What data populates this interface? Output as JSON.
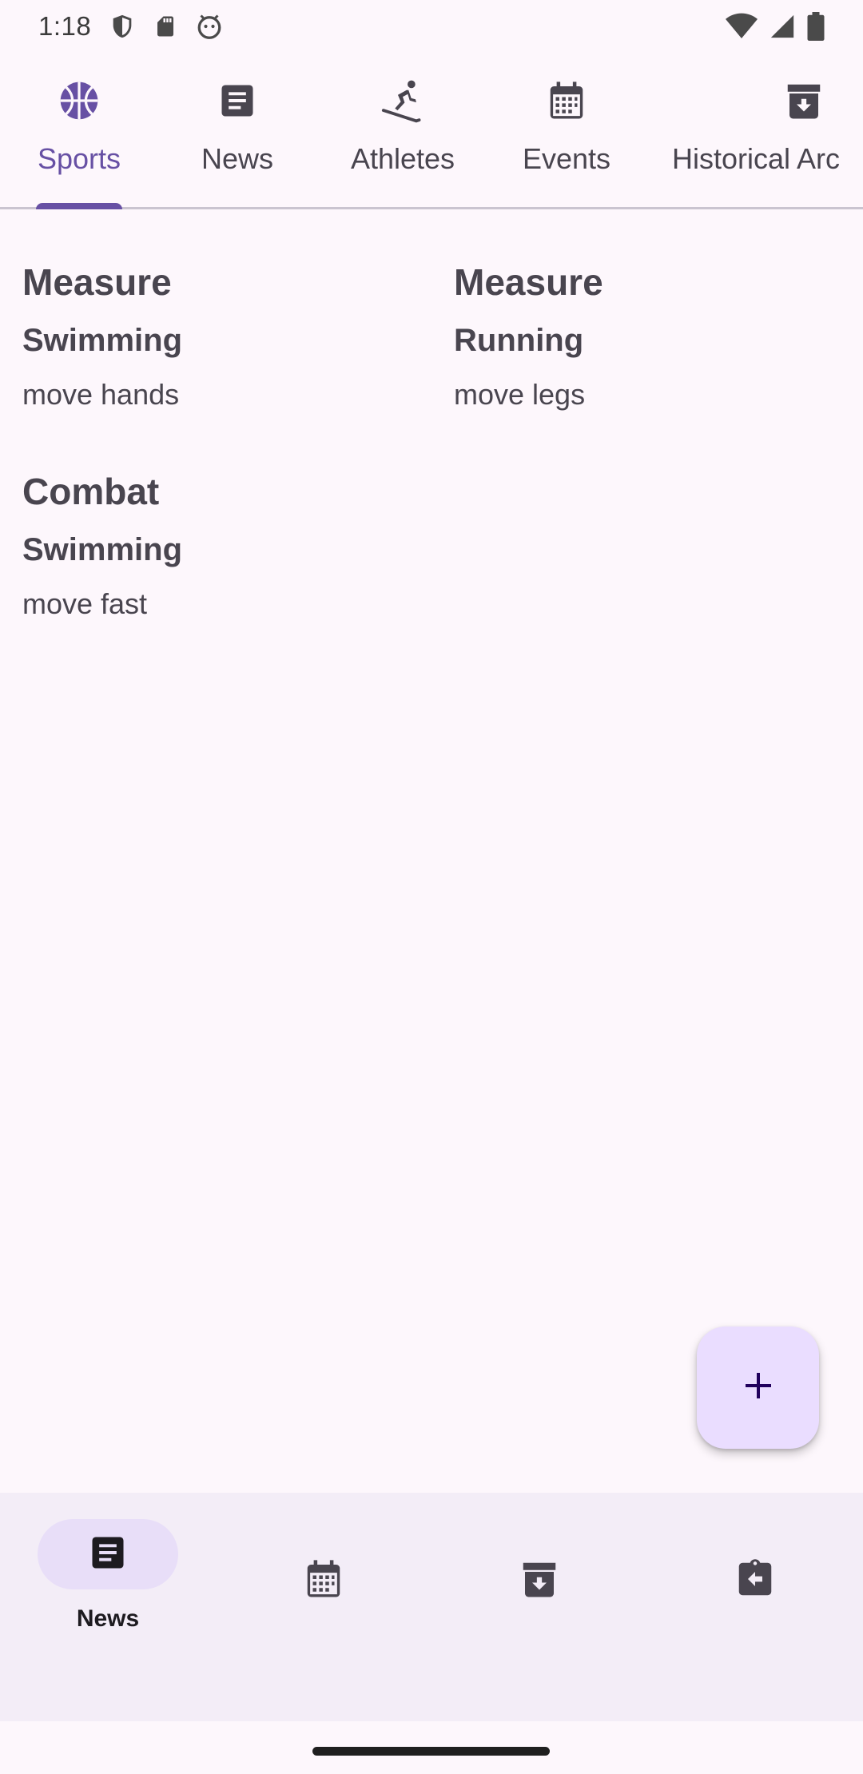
{
  "status_bar": {
    "time": "1:18"
  },
  "tabs": [
    {
      "label": "Sports",
      "icon": "basketball-icon",
      "active": true
    },
    {
      "label": "News",
      "icon": "article-icon",
      "active": false
    },
    {
      "label": "Athletes",
      "icon": "skier-icon",
      "active": false
    },
    {
      "label": "Events",
      "icon": "calendar-icon",
      "active": false
    },
    {
      "label": "Historical Arc",
      "icon": "archive-icon",
      "active": false
    }
  ],
  "cards": [
    {
      "category": "Measure",
      "title": "Swimming",
      "description": "move hands"
    },
    {
      "category": "Measure",
      "title": "Running",
      "description": "move legs"
    },
    {
      "category": "Combat",
      "title": "Swimming",
      "description": "move fast"
    }
  ],
  "fab": {
    "icon": "plus-icon"
  },
  "bottom_nav": {
    "items": [
      {
        "label": "News",
        "icon": "article-icon",
        "active": true
      },
      {
        "label": "",
        "icon": "calendar-icon",
        "active": false
      },
      {
        "label": "",
        "icon": "archive-icon",
        "active": false
      },
      {
        "label": "",
        "icon": "assignment-return-icon",
        "active": false
      }
    ]
  },
  "colors": {
    "primary": "#6750A4",
    "background": "#FDF7FC",
    "nav_background": "#F3EDF7",
    "fab_background": "#EADDFF",
    "text": "#49454F"
  }
}
